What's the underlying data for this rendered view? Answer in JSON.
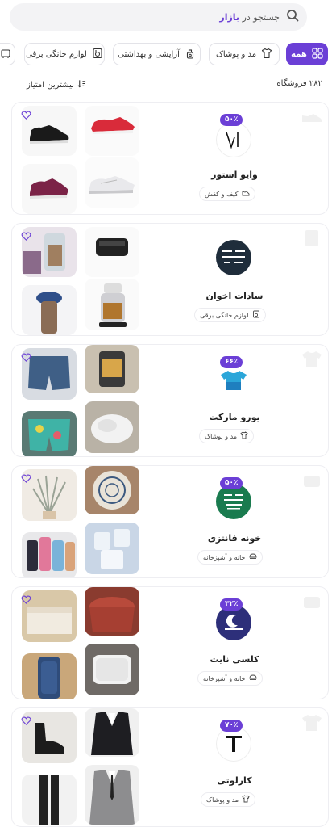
{
  "search": {
    "prefix": "جستجو در",
    "brand": "بازار"
  },
  "categories": [
    {
      "label": "همه",
      "icon": "grid-icon",
      "active": true
    },
    {
      "label": "مد و پوشاک",
      "icon": "shirt-icon",
      "active": false
    },
    {
      "label": "آرایشی و بهداشتی",
      "icon": "cosmetics-icon",
      "active": false
    },
    {
      "label": "لوازم خانگی برقی",
      "icon": "appliance-icon",
      "active": false
    }
  ],
  "results": {
    "count_label": "۲۸۲ فروشگاه",
    "sort_label": "بیشترین امتیاز"
  },
  "shops": [
    {
      "name": "وایو استور",
      "discount": "۵۰٪",
      "category": "کیف و کفش",
      "category_icon": "shoe-icon"
    },
    {
      "name": "سادات اخوان",
      "discount": "",
      "category": "لوازم خانگی برقی",
      "category_icon": "appliance-icon"
    },
    {
      "name": "یورو مارکت",
      "discount": "۶۶٪",
      "category": "مد و پوشاک",
      "category_icon": "shirt-icon"
    },
    {
      "name": "خونه فانتزی",
      "discount": "۵۰٪",
      "category": "خانه و آشپزخانه",
      "category_icon": "kitchen-icon"
    },
    {
      "name": "کلسی نایت",
      "discount": "۳۲٪",
      "category": "خانه و آشپزخانه",
      "category_icon": "kitchen-icon"
    },
    {
      "name": "کارلوتی",
      "discount": "۷۰٪",
      "category": "مد و پوشاک",
      "category_icon": "shirt-icon"
    }
  ],
  "colors": {
    "accent": "#6b3fd6",
    "border": "#eeeef2"
  }
}
